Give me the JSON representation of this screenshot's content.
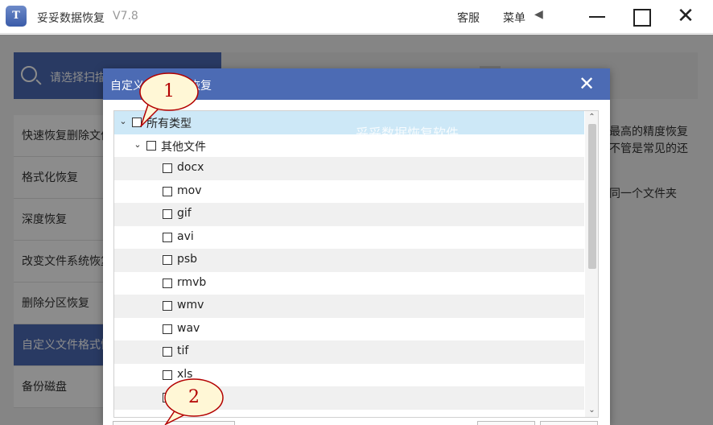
{
  "app": {
    "logo_text": "T",
    "title": "妥妥数据恢复",
    "version": "V7.8",
    "service_label": "客服",
    "menu_label": "菜单",
    "menu_arrow": "◀"
  },
  "window_controls": {
    "minimize": "minimize-icon",
    "maximize": "maximize-icon",
    "close": "close-icon"
  },
  "background": {
    "step_label": "请选择扫描",
    "side_menu": [
      {
        "label": "快速恢复删除文件",
        "active": false
      },
      {
        "label": "格式化恢复",
        "active": false
      },
      {
        "label": "深度恢复",
        "active": false
      },
      {
        "label": "改变文件系统恢复",
        "active": false
      },
      {
        "label": "删除分区恢复",
        "active": false
      },
      {
        "label": "自定义文件格式恢复",
        "active": true
      },
      {
        "label": "备份磁盘",
        "active": false
      }
    ],
    "desc_lines": [
      "最高的精度恢复",
      "不管是常见的还",
      "同一个文件夹"
    ]
  },
  "dialog": {
    "title": "自定义文件格式恢复",
    "close_glyph": "✕",
    "watermark": "妥妥数据恢复软件",
    "tree": [
      {
        "label": "所有类型",
        "level": 0,
        "expanded": true,
        "checked": false,
        "selected": true
      },
      {
        "label": "其他文件",
        "level": 1,
        "expanded": true,
        "checked": false,
        "selected": false
      },
      {
        "label": "docx",
        "level": 2,
        "checked": false
      },
      {
        "label": "mov",
        "level": 2,
        "checked": false
      },
      {
        "label": "gif",
        "level": 2,
        "checked": false
      },
      {
        "label": "avi",
        "level": 2,
        "checked": false
      },
      {
        "label": "psb",
        "level": 2,
        "checked": false
      },
      {
        "label": "rmvb",
        "level": 2,
        "checked": false
      },
      {
        "label": "wmv",
        "level": 2,
        "checked": false
      },
      {
        "label": "wav",
        "level": 2,
        "checked": false
      },
      {
        "label": "tif",
        "level": 2,
        "checked": false
      },
      {
        "label": "xls",
        "level": 2,
        "checked": false
      },
      {
        "label": "",
        "level": 2,
        "checked": false
      }
    ],
    "scroll_up": "⌃",
    "scroll_down": "⌄"
  },
  "callouts": [
    {
      "number": "1"
    },
    {
      "number": "2"
    }
  ],
  "colors": {
    "accent": "#4c6bb4",
    "selected_row": "#cde8f7",
    "callout_fill": "#fff7d6",
    "callout_text": "#b30000"
  }
}
